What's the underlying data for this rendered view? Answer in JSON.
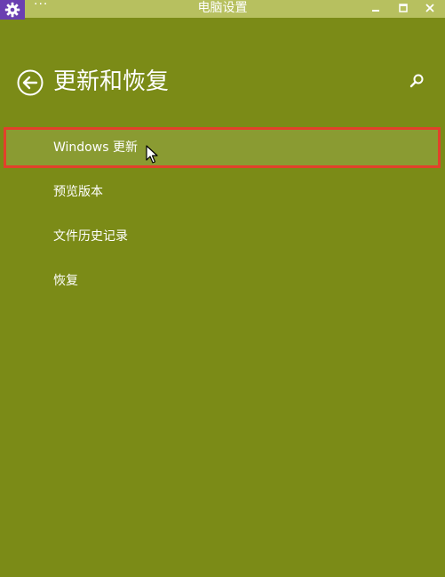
{
  "window": {
    "title": "电脑设置",
    "menu_glyph": "···",
    "controls": [
      "minimize",
      "maximize",
      "close"
    ]
  },
  "header": {
    "title": "更新和恢复",
    "back_icon": "back-arrow-icon",
    "search_icon": "search-icon"
  },
  "nav": {
    "items": [
      {
        "label": "Windows 更新",
        "selected": true
      },
      {
        "label": "预览版本",
        "selected": false
      },
      {
        "label": "文件历史记录",
        "selected": false
      },
      {
        "label": "恢复",
        "selected": false
      }
    ]
  },
  "colors": {
    "background": "#7b8b17",
    "titlebar": "#b7c05f",
    "app_icon_bg": "#6a3fb1",
    "selected_bg": "#8a9b32",
    "highlight_border": "#e2412b"
  }
}
